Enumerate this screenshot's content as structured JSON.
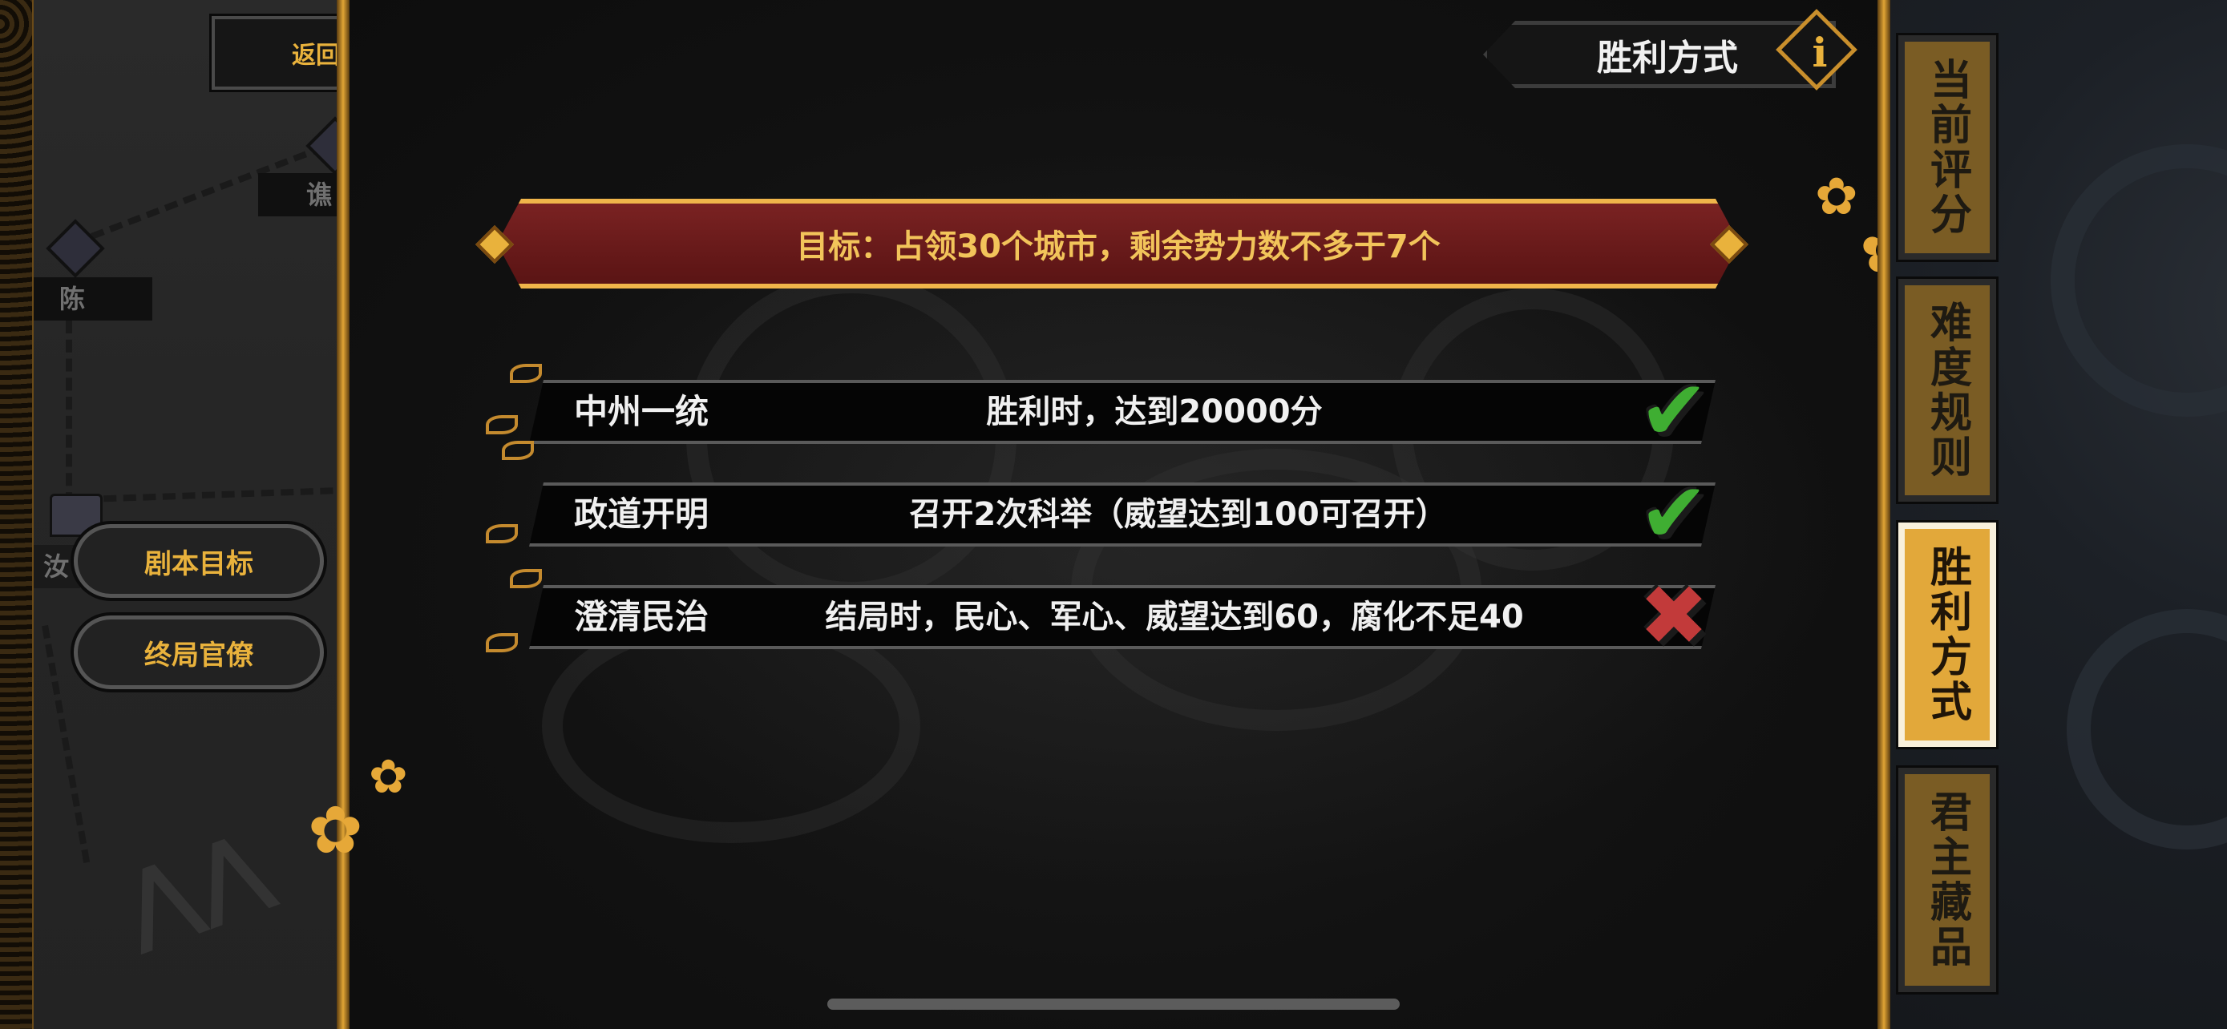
{
  "nav": {
    "back_label": "返回"
  },
  "map": {
    "cities": [
      "谯",
      "陈",
      "汝"
    ]
  },
  "left_menu": {
    "scenario_goal": "剧本目标",
    "final_officials": "终局官僚"
  },
  "header": {
    "title": "胜利方式",
    "info_symbol": "i"
  },
  "goal": {
    "text": "目标：占领30个城市，剩余势力数不多于7个"
  },
  "objectives": [
    {
      "name": "中州一统",
      "description": "胜利时，达到20000分",
      "status": "complete"
    },
    {
      "name": "政道开明",
      "description": "召开2次科举（威望达到100可召开）",
      "status": "complete"
    },
    {
      "name": "澄清民治",
      "description": "结局时，民心、军心、威望达到60，腐化不足40",
      "status": "failed"
    }
  ],
  "status_icons": {
    "complete": "✔",
    "failed": "✖"
  },
  "side_tabs": [
    {
      "label": "当前评分",
      "active": false
    },
    {
      "label": "难度规则",
      "active": false
    },
    {
      "label": "胜利方式",
      "active": true
    },
    {
      "label": "君主藏品",
      "active": false
    }
  ],
  "colors": {
    "accent_gold": "#e9b23c",
    "banner_red": "#6a1a1a",
    "check_green": "#3fae32",
    "cross_red": "#c23a3a"
  }
}
